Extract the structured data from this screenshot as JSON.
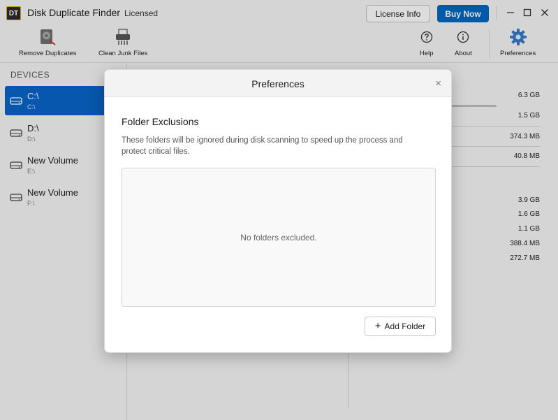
{
  "app": {
    "logo_text": "DT",
    "title": "Disk Duplicate Finder",
    "license_status": "Licensed",
    "license_button": "License Info",
    "buy_button": "Buy Now",
    "accent_color": "#0067c0"
  },
  "window_controls": {
    "minimize": "—",
    "maximize": "☐",
    "close": "✕"
  },
  "toolbar": {
    "remove_duplicates": "Remove Duplicates",
    "clean_junk": "Clean Junk Files",
    "help": "Help",
    "about": "About",
    "preferences": "Preferences"
  },
  "sidebar": {
    "heading": "DEVICES",
    "devices": [
      {
        "name": "C:\\",
        "path": "C:\\",
        "selected": true
      },
      {
        "name": "D:\\",
        "path": "D:\\",
        "selected": false
      },
      {
        "name": "New Volume",
        "path": "E:\\",
        "selected": false
      },
      {
        "name": "New Volume",
        "path": "F:\\",
        "selected": false
      }
    ]
  },
  "background_sizes": {
    "top": [
      "6.3 GB",
      "1.5 GB",
      "374.3 MB",
      "40.8 MB"
    ],
    "bottom": [
      "3.9 GB",
      "1.6 GB",
      "1.1 GB",
      "388.4 MB",
      "272.7 MB"
    ]
  },
  "dialog": {
    "title": "Preferences",
    "close": "×",
    "section_title": "Folder Exclusions",
    "description": "These folders will be ignored during disk scanning to speed up the process and protect critical files.",
    "empty_message": "No folders excluded.",
    "add_button": "Add Folder",
    "add_icon": "+"
  }
}
